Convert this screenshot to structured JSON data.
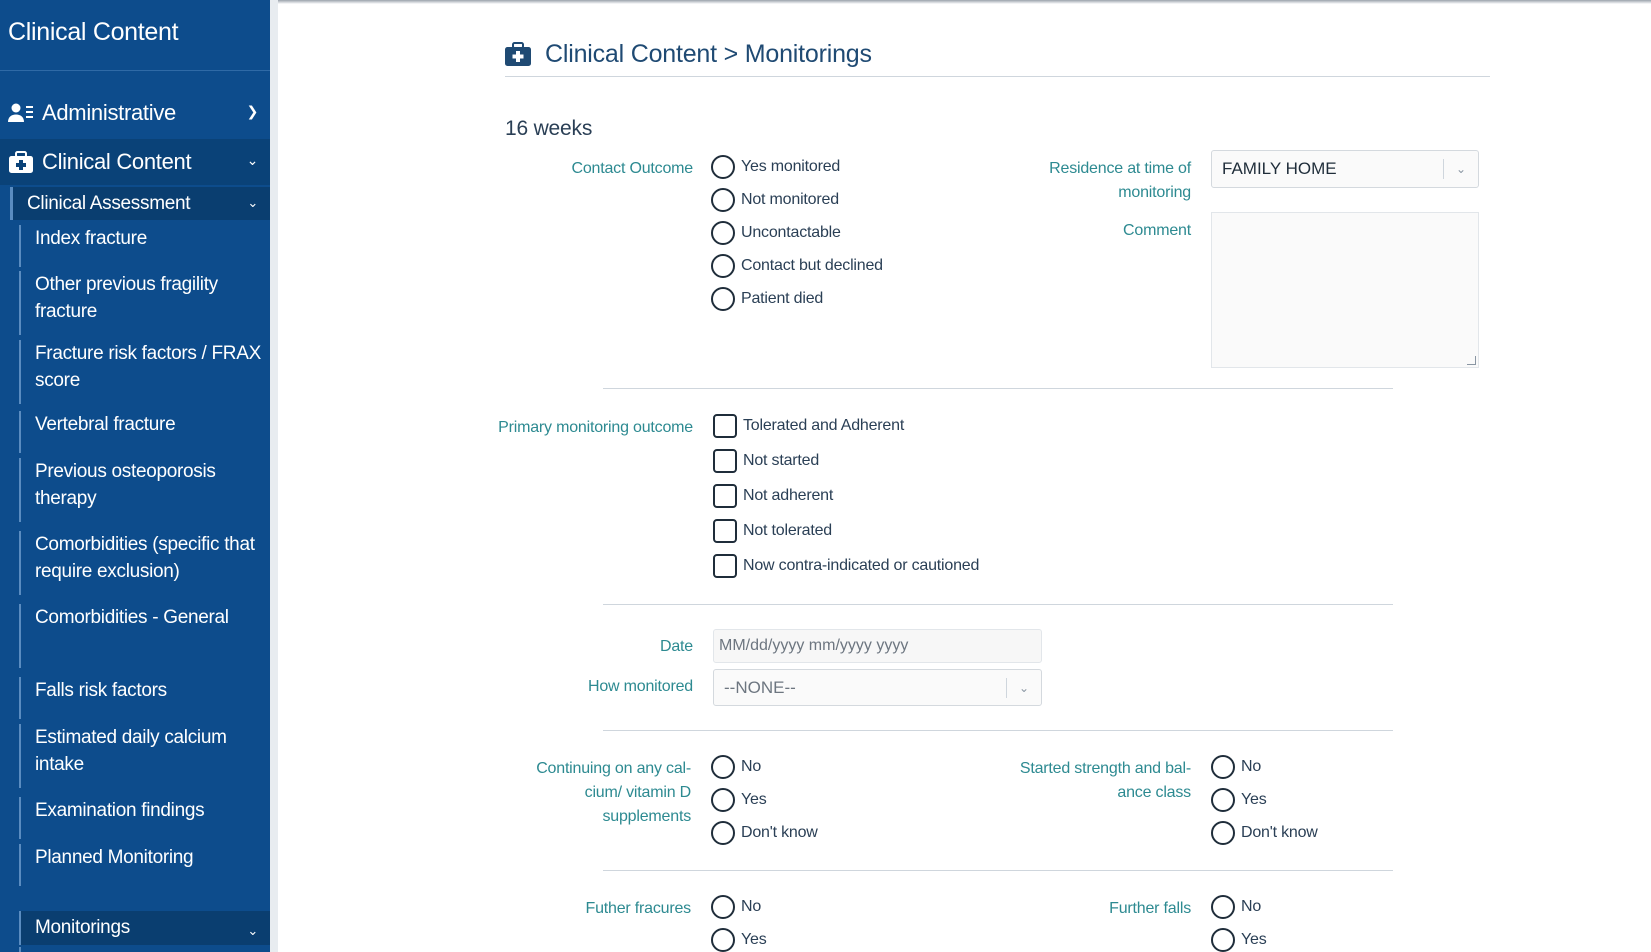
{
  "sidebar": {
    "app_title": "Clinical Content",
    "administrative": "Administrative",
    "clinical_content": "Clinical Content",
    "clinical_assessment": "Clinical Assessment",
    "items": [
      {
        "label": "Index fracture"
      },
      {
        "label": "Other previous fragility fracture"
      },
      {
        "label": "Fracture risk factors / FRAX score"
      },
      {
        "label": "Vertebral fracture"
      },
      {
        "label": "Previous osteoporosis therapy"
      },
      {
        "label": "Comorbidities (specific that require exclusion)"
      },
      {
        "label": "Comorbidities - General"
      },
      {
        "label": "Falls risk factors"
      },
      {
        "label": "Estimated daily calcium intake"
      },
      {
        "label": "Examination findings"
      },
      {
        "label": "Planned Monitoring"
      },
      {
        "label": "Monitorings"
      }
    ]
  },
  "header": {
    "breadcrumb": "Clinical Content > Monitorings"
  },
  "form": {
    "section_title": "16 weeks",
    "contact_outcome": {
      "label": "Contact Outcome",
      "options": [
        "Yes monitored",
        "Not monitored",
        "Uncontactable",
        "Contact but declined",
        "Patient died"
      ]
    },
    "residence": {
      "label": "Residence at time of monitoring",
      "value": "FAMILY HOME"
    },
    "comment": {
      "label": "Comment",
      "value": ""
    },
    "primary_outcome": {
      "label": "Primary monitoring outcome",
      "options": [
        "Tolerated and Adherent",
        "Not started",
        "Not adherent",
        "Not tolerated",
        "Now contra-indicated or cautioned"
      ]
    },
    "date": {
      "label": "Date",
      "placeholder": "MM/dd/yyyy mm/yyyy yyyy"
    },
    "how_monitored": {
      "label": "How monitored",
      "value": "--NONE--"
    },
    "calcium": {
      "label": "Continuing on any cal-cium/ vitamin D supplements",
      "options": [
        "No",
        "Yes",
        "Don't know"
      ]
    },
    "strength": {
      "label": "Started strength and bal-ance class",
      "options": [
        "No",
        "Yes",
        "Don't know"
      ]
    },
    "further_fractures": {
      "label": "Futher fracures",
      "options": [
        "No",
        "Yes"
      ]
    },
    "further_falls": {
      "label": "Further falls",
      "options": [
        "No",
        "Yes"
      ]
    }
  }
}
